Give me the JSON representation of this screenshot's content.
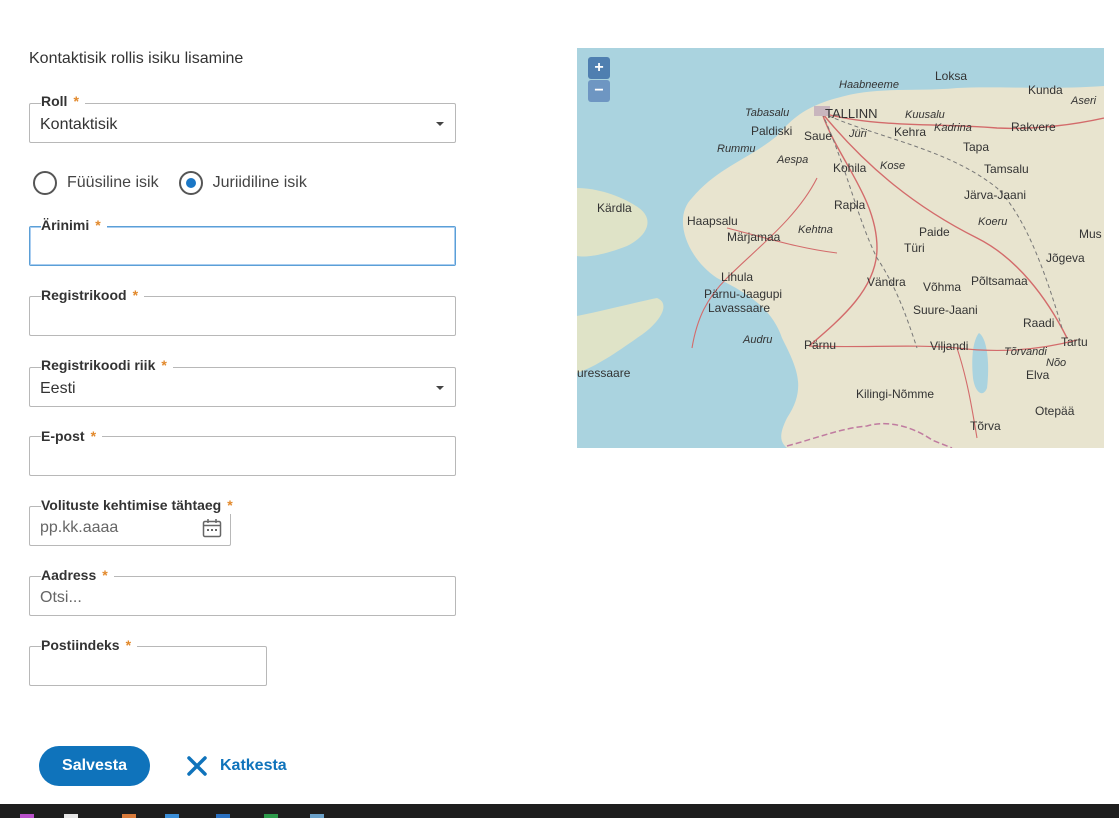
{
  "page": {
    "title": "Kontaktisik rollis isiku lisamine"
  },
  "form": {
    "role": {
      "label": "Roll",
      "value": "Kontaktisik",
      "required_mark": "*"
    },
    "person_type": {
      "options": [
        {
          "label": "Füüsiline isik",
          "checked": false
        },
        {
          "label": "Juriidiline isik",
          "checked": true
        }
      ]
    },
    "business_name": {
      "label": "Ärinimi",
      "value": "",
      "required_mark": "*"
    },
    "reg_code": {
      "label": "Registrikood",
      "value": "",
      "required_mark": "*"
    },
    "reg_country": {
      "label": "Registrikoodi riik",
      "value": "Eesti",
      "required_mark": "*"
    },
    "email": {
      "label": "E-post",
      "value": "",
      "required_mark": "*"
    },
    "authority_deadline": {
      "label": "Volituste kehtimise tähtaeg",
      "placeholder": "pp.kk.aaaa",
      "required_mark": "*"
    },
    "address": {
      "label": "Aadress",
      "placeholder": "Otsi...",
      "required_mark": "*"
    },
    "postal_code": {
      "label": "Postiindeks",
      "value": "",
      "required_mark": "*"
    }
  },
  "actions": {
    "save_label": "Salvesta",
    "cancel_label": "Katkesta"
  },
  "map": {
    "zoom_in": "+",
    "zoom_out": "−",
    "places": [
      "Haabneeme",
      "Loksa",
      "Kunda",
      "Aseri",
      "Tabasalu",
      "TALLINN",
      "Kuusalu",
      "Paldiski",
      "Saue",
      "Jüri",
      "Kehra",
      "Kadrina",
      "Rakvere",
      "Rummu",
      "Aespa",
      "Tapa",
      "Kohila",
      "Kose",
      "Tamsalu",
      "Kärdla",
      "Rapla",
      "Järva-Jaani",
      "Haapsalu",
      "Kehtna",
      "Koeru",
      "Märjamaa",
      "Paide",
      "Mus",
      "Türi",
      "Jõgeva",
      "Lihula",
      "Vändra",
      "Võhma",
      "Põltsamaa",
      "Pärnu-Jaagupi",
      "Lavassaare",
      "Suure-Jaani",
      "Raadi",
      "Audru",
      "Pärnu",
      "Viljandi",
      "Tartu",
      "Tõrvandi",
      "uressaare",
      "Elva",
      "Nõo",
      "Kilingi-Nõmme",
      "Otepää",
      "Tõrva"
    ]
  },
  "colors": {
    "accent": "#0f73bb",
    "required": "#e2892c",
    "focus": "#5b9fd6"
  }
}
